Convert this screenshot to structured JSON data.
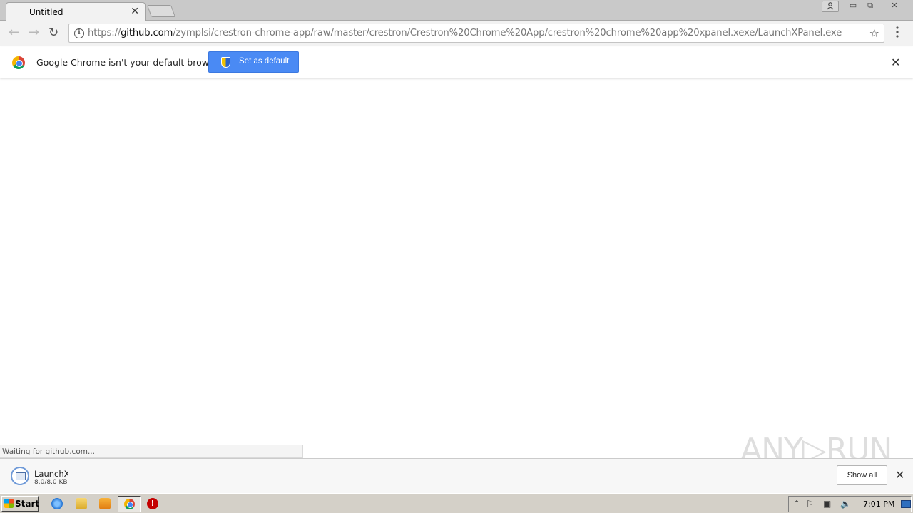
{
  "browser": {
    "tab": {
      "title": "Untitled",
      "close_glyph": "✕"
    },
    "window_controls": {
      "user_icon": "person-icon",
      "minimize": "▭",
      "maximize": "⧉",
      "close": "✕"
    },
    "toolbar": {
      "back_glyph": "←",
      "forward_glyph": "→",
      "reload_glyph": "↻",
      "url_scheme": "https://",
      "url_host": "github.com",
      "url_path": "/zymplsi/crestron-chrome-app/raw/master/crestron/Crestron%20Chrome%20App/crestron%20chrome%20app%20xpanel.xexe/LaunchXPanel.exe",
      "info_glyph": "i",
      "star_glyph": "☆",
      "menu_glyph": "⋮"
    },
    "infobar": {
      "message": "Google Chrome isn't your default browser",
      "button_label": "Set as default",
      "close_glyph": "✕"
    },
    "status_text": "Waiting for github.com...",
    "watermark": "ANY▷RUN"
  },
  "download_shelf": {
    "item": {
      "name": "LaunchXPanel.exe",
      "size": "8.0/8.0 KB"
    },
    "show_all_label": "Show all",
    "close_glyph": "✕"
  },
  "taskbar": {
    "start_label": "Start",
    "clock": "7:01 PM",
    "tray": {
      "up": "⌃",
      "flag": "⚐",
      "net": "▣",
      "vol": "🔈"
    },
    "stop_glyph": "!"
  }
}
